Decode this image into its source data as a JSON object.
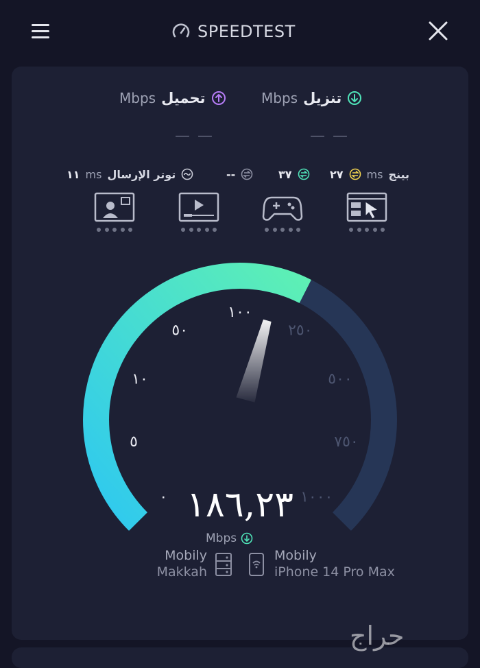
{
  "header": {
    "brand": "SPEEDTEST",
    "menu_icon": "hamburger-menu-icon",
    "close_icon": "close-icon"
  },
  "results": {
    "download": {
      "label": "تنزيل",
      "unit": "Mbps",
      "value": "— —",
      "icon": "download-arrow-icon",
      "color": "#4fe3b8"
    },
    "upload": {
      "label": "تحميل",
      "unit": "Mbps",
      "value": "— —",
      "icon": "upload-arrow-icon",
      "color": "#b57cf5"
    }
  },
  "latency": {
    "ping_label": "بينج",
    "ping_unit": "ms",
    "idle_value": "٢٧",
    "download_value": "٣٧",
    "upload_value": "--",
    "jitter_label": "توتر الإرسال",
    "jitter_unit": "ms",
    "jitter_value": "١١"
  },
  "qos_icons": [
    "video-call-icon",
    "video-streaming-icon",
    "gaming-controller-icon",
    "web-browsing-icon"
  ],
  "gauge": {
    "ticks": [
      "٠",
      "٥",
      "١٠",
      "٥٠",
      "١٠٠",
      "٢٥٠",
      "٥٠٠",
      "٧٥٠",
      "١٠٠٠"
    ],
    "fill_fraction": 0.6,
    "active_color_start": "#2ec8f0",
    "active_color_end": "#5ef0b4",
    "track_color": "#263656"
  },
  "speed": {
    "value": "١٨٦,٢٣",
    "unit": "Mbps"
  },
  "server": {
    "provider": "Mobily",
    "location": "Makkah",
    "icon": "server-icon"
  },
  "device": {
    "provider": "Mobily",
    "model": "iPhone 14 Pro Max",
    "icon": "phone-wifi-icon"
  },
  "watermark": "حراج"
}
